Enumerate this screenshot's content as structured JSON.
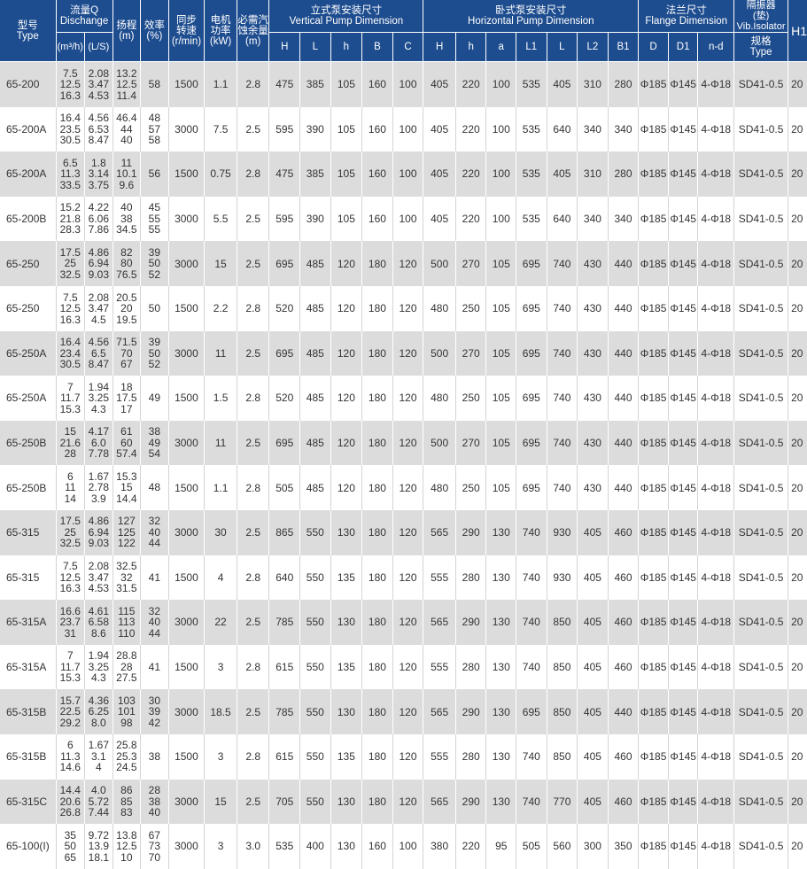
{
  "header": {
    "type": "型号\nType",
    "flow": "流量Q\nDischange",
    "flow_unit_m3": "(m³/h)",
    "flow_unit_ls": "(L/S)",
    "head": "扬程\n(m)",
    "eff": "效率\n(%)",
    "speed": "同步\n转速\n(r/min)",
    "power": "电机\n功率\n(kW)",
    "npsh": "必需汽\n蚀余量\n(m)",
    "vertical": "立式泵安装尺寸\nVertical Pump Dimension",
    "horizontal": "卧式泵安装尺寸\nHorizontal Pump Dimension",
    "flange": "法兰尺寸\nFlange Dimension",
    "isolator": "隔振器\n(垫)\nVib.Isolator",
    "isolator_type": "规格\nType",
    "h1": "H1",
    "v_cols": [
      "H",
      "L",
      "h",
      "B",
      "C"
    ],
    "h_cols": [
      "H",
      "h",
      "a",
      "L1",
      "L",
      "L2",
      "B1"
    ],
    "f_cols": [
      "D",
      "D1",
      "n-d"
    ]
  },
  "rows": [
    {
      "type": "65-200",
      "q": "7.5\n12.5\n16.3",
      "ls": "2.08\n3.47\n4.53",
      "head": "13.2\n12.5\n11.4",
      "eff": "58",
      "speed": "1500",
      "power": "1.1",
      "npsh": "2.8",
      "v": [
        "475",
        "385",
        "105",
        "160",
        "100"
      ],
      "hz": [
        "405",
        "220",
        "100",
        "535",
        "405",
        "310",
        "280"
      ],
      "f": [
        "Φ185",
        "Φ145",
        "4-Φ18"
      ],
      "iso": "SD41-0.5",
      "h1": "20"
    },
    {
      "type": "65-200A",
      "q": "16.4\n23.5\n30.5",
      "ls": "4.56\n6.53\n8.47",
      "head": "46.4\n44\n40",
      "eff": "48\n57\n58",
      "speed": "3000",
      "power": "7.5",
      "npsh": "2.5",
      "v": [
        "595",
        "390",
        "105",
        "160",
        "100"
      ],
      "hz": [
        "405",
        "220",
        "100",
        "535",
        "640",
        "340",
        "340"
      ],
      "f": [
        "Φ185",
        "Φ145",
        "4-Φ18"
      ],
      "iso": "SD41-0.5",
      "h1": "20"
    },
    {
      "type": "65-200A",
      "q": "6.5\n11.3\n33.5",
      "ls": "1.8\n3.14\n3.75",
      "head": "11\n10.1\n9.6",
      "eff": "56",
      "speed": "1500",
      "power": "0.75",
      "npsh": "2.8",
      "v": [
        "475",
        "385",
        "105",
        "160",
        "100"
      ],
      "hz": [
        "405",
        "220",
        "100",
        "535",
        "405",
        "310",
        "280"
      ],
      "f": [
        "Φ185",
        "Φ145",
        "4-Φ18"
      ],
      "iso": "SD41-0.5",
      "h1": "20"
    },
    {
      "type": "65-200B",
      "q": "15.2\n21.8\n28.3",
      "ls": "4.22\n6.06\n7.86",
      "head": "40\n38\n34.5",
      "eff": "45\n55\n55",
      "speed": "3000",
      "power": "5.5",
      "npsh": "2.5",
      "v": [
        "595",
        "390",
        "105",
        "160",
        "100"
      ],
      "hz": [
        "405",
        "220",
        "100",
        "535",
        "640",
        "340",
        "340"
      ],
      "f": [
        "Φ185",
        "Φ145",
        "4-Φ18"
      ],
      "iso": "SD41-0.5",
      "h1": "20"
    },
    {
      "type": "65-250",
      "q": "17.5\n25\n32.5",
      "ls": "4.86\n6.94\n9.03",
      "head": "82\n80\n76.5",
      "eff": "39\n50\n52",
      "speed": "3000",
      "power": "15",
      "npsh": "2.5",
      "v": [
        "695",
        "485",
        "120",
        "180",
        "120"
      ],
      "hz": [
        "500",
        "270",
        "105",
        "695",
        "740",
        "430",
        "440"
      ],
      "f": [
        "Φ185",
        "Φ145",
        "4-Φ18"
      ],
      "iso": "SD41-0.5",
      "h1": "20"
    },
    {
      "type": "65-250",
      "q": "7.5\n12.5\n16.3",
      "ls": "2.08\n3.47\n4.5",
      "head": "20.5\n20\n19.5",
      "eff": "50",
      "speed": "1500",
      "power": "2.2",
      "npsh": "2.8",
      "v": [
        "520",
        "485",
        "120",
        "180",
        "120"
      ],
      "hz": [
        "480",
        "250",
        "105",
        "695",
        "740",
        "430",
        "440"
      ],
      "f": [
        "Φ185",
        "Φ145",
        "4-Φ18"
      ],
      "iso": "SD41-0.5",
      "h1": "20"
    },
    {
      "type": "65-250A",
      "q": "16.4\n23.4\n30.5",
      "ls": "4.56\n6.5\n8.47",
      "head": "71.5\n70\n67",
      "eff": "39\n50\n52",
      "speed": "3000",
      "power": "11",
      "npsh": "2.5",
      "v": [
        "695",
        "485",
        "120",
        "180",
        "120"
      ],
      "hz": [
        "500",
        "270",
        "105",
        "695",
        "740",
        "430",
        "440"
      ],
      "f": [
        "Φ185",
        "Φ145",
        "4-Φ18"
      ],
      "iso": "SD41-0.5",
      "h1": "20"
    },
    {
      "type": "65-250A",
      "q": "7\n11.7\n15.3",
      "ls": "1.94\n3.25\n4.3",
      "head": "18\n17.5\n17",
      "eff": "49",
      "speed": "1500",
      "power": "1.5",
      "npsh": "2.8",
      "v": [
        "520",
        "485",
        "120",
        "180",
        "120"
      ],
      "hz": [
        "480",
        "250",
        "105",
        "695",
        "740",
        "430",
        "440"
      ],
      "f": [
        "Φ185",
        "Φ145",
        "4-Φ18"
      ],
      "iso": "SD41-0.5",
      "h1": "20"
    },
    {
      "type": "65-250B",
      "q": "15\n21.6\n28",
      "ls": "4.17\n6.0\n7.78",
      "head": "61\n60\n57.4",
      "eff": "38\n49\n54",
      "speed": "3000",
      "power": "11",
      "npsh": "2.5",
      "v": [
        "695",
        "485",
        "120",
        "180",
        "120"
      ],
      "hz": [
        "500",
        "270",
        "105",
        "695",
        "740",
        "430",
        "440"
      ],
      "f": [
        "Φ185",
        "Φ145",
        "4-Φ18"
      ],
      "iso": "SD41-0.5",
      "h1": "20"
    },
    {
      "type": "65-250B",
      "q": "6\n11\n14",
      "ls": "1.67\n2.78\n3.9",
      "head": "15.3\n15\n14.4",
      "eff": "48",
      "speed": "1500",
      "power": "1.1",
      "npsh": "2.8",
      "v": [
        "505",
        "485",
        "120",
        "180",
        "120"
      ],
      "hz": [
        "480",
        "250",
        "105",
        "695",
        "740",
        "430",
        "440"
      ],
      "f": [
        "Φ185",
        "Φ145",
        "4-Φ18"
      ],
      "iso": "SD41-0.5",
      "h1": "20"
    },
    {
      "type": "65-315",
      "q": "17.5\n25\n32.5",
      "ls": "4.86\n6.94\n9.03",
      "head": "127\n125\n122",
      "eff": "32\n40\n44",
      "speed": "3000",
      "power": "30",
      "npsh": "2.5",
      "v": [
        "865",
        "550",
        "130",
        "180",
        "120"
      ],
      "hz": [
        "565",
        "290",
        "130",
        "740",
        "930",
        "405",
        "460"
      ],
      "f": [
        "Φ185",
        "Φ145",
        "4-Φ18"
      ],
      "iso": "SD41-0.5",
      "h1": "20"
    },
    {
      "type": "65-315",
      "q": "7.5\n12.5\n16.3",
      "ls": "2.08\n3.47\n4.53",
      "head": "32.5\n32\n31.5",
      "eff": "41",
      "speed": "1500",
      "power": "4",
      "npsh": "2.8",
      "v": [
        "640",
        "550",
        "135",
        "180",
        "120"
      ],
      "hz": [
        "555",
        "280",
        "130",
        "740",
        "930",
        "405",
        "460"
      ],
      "f": [
        "Φ185",
        "Φ145",
        "4-Φ18"
      ],
      "iso": "SD41-0.5",
      "h1": "20"
    },
    {
      "type": "65-315A",
      "q": "16.6\n23.7\n31",
      "ls": "4.61\n6.58\n8.6",
      "head": "115\n113\n110",
      "eff": "32\n40\n44",
      "speed": "3000",
      "power": "22",
      "npsh": "2.5",
      "v": [
        "785",
        "550",
        "130",
        "180",
        "120"
      ],
      "hz": [
        "565",
        "290",
        "130",
        "740",
        "850",
        "405",
        "460"
      ],
      "f": [
        "Φ185",
        "Φ145",
        "4-Φ18"
      ],
      "iso": "SD41-0.5",
      "h1": "20"
    },
    {
      "type": "65-315A",
      "q": "7\n11.7\n15.3",
      "ls": "1.94\n3.25\n4.3",
      "head": "28.8\n28\n27.5",
      "eff": "41",
      "speed": "1500",
      "power": "3",
      "npsh": "2.8",
      "v": [
        "615",
        "550",
        "135",
        "180",
        "120"
      ],
      "hz": [
        "555",
        "280",
        "130",
        "740",
        "850",
        "405",
        "460"
      ],
      "f": [
        "Φ185",
        "Φ145",
        "4-Φ18"
      ],
      "iso": "SD41-0.5",
      "h1": "20"
    },
    {
      "type": "65-315B",
      "q": "15.7\n22.5\n29.2",
      "ls": "4.36\n6.25\n8.0",
      "head": "103\n101\n98",
      "eff": "30\n39\n42",
      "speed": "3000",
      "power": "18.5",
      "npsh": "2.5",
      "v": [
        "785",
        "550",
        "130",
        "180",
        "120"
      ],
      "hz": [
        "565",
        "290",
        "130",
        "695",
        "850",
        "405",
        "440"
      ],
      "f": [
        "Φ185",
        "Φ145",
        "4-Φ18"
      ],
      "iso": "SD41-0.5",
      "h1": "20"
    },
    {
      "type": "65-315B",
      "q": "6\n11.3\n14.6",
      "ls": "1.67\n3.1\n4",
      "head": "25.8\n25.3\n24.5",
      "eff": "38",
      "speed": "1500",
      "power": "3",
      "npsh": "2.8",
      "v": [
        "615",
        "550",
        "135",
        "180",
        "120"
      ],
      "hz": [
        "555",
        "280",
        "130",
        "740",
        "850",
        "405",
        "460"
      ],
      "f": [
        "Φ185",
        "Φ145",
        "4-Φ18"
      ],
      "iso": "SD41-0.5",
      "h1": "20"
    },
    {
      "type": "65-315C",
      "q": "14.4\n20.6\n26.8",
      "ls": "4.0\n5.72\n7.44",
      "head": "86\n85\n83",
      "eff": "28\n38\n40",
      "speed": "3000",
      "power": "15",
      "npsh": "2.5",
      "v": [
        "705",
        "550",
        "130",
        "180",
        "120"
      ],
      "hz": [
        "565",
        "290",
        "130",
        "740",
        "770",
        "405",
        "460"
      ],
      "f": [
        "Φ185",
        "Φ145",
        "4-Φ18"
      ],
      "iso": "SD41-0.5",
      "h1": "20"
    },
    {
      "type": "65-100(I)",
      "q": "35\n50\n65",
      "ls": "9.72\n13.9\n18.1",
      "head": "13.8\n12.5\n10",
      "eff": "67\n73\n70",
      "speed": "3000",
      "power": "3",
      "npsh": "3.0",
      "v": [
        "535",
        "400",
        "130",
        "160",
        "100"
      ],
      "hz": [
        "380",
        "220",
        "95",
        "505",
        "560",
        "300",
        "350"
      ],
      "f": [
        "Φ185",
        "Φ145",
        "4-Φ18"
      ],
      "iso": "SD41-0.5",
      "h1": "20"
    }
  ]
}
